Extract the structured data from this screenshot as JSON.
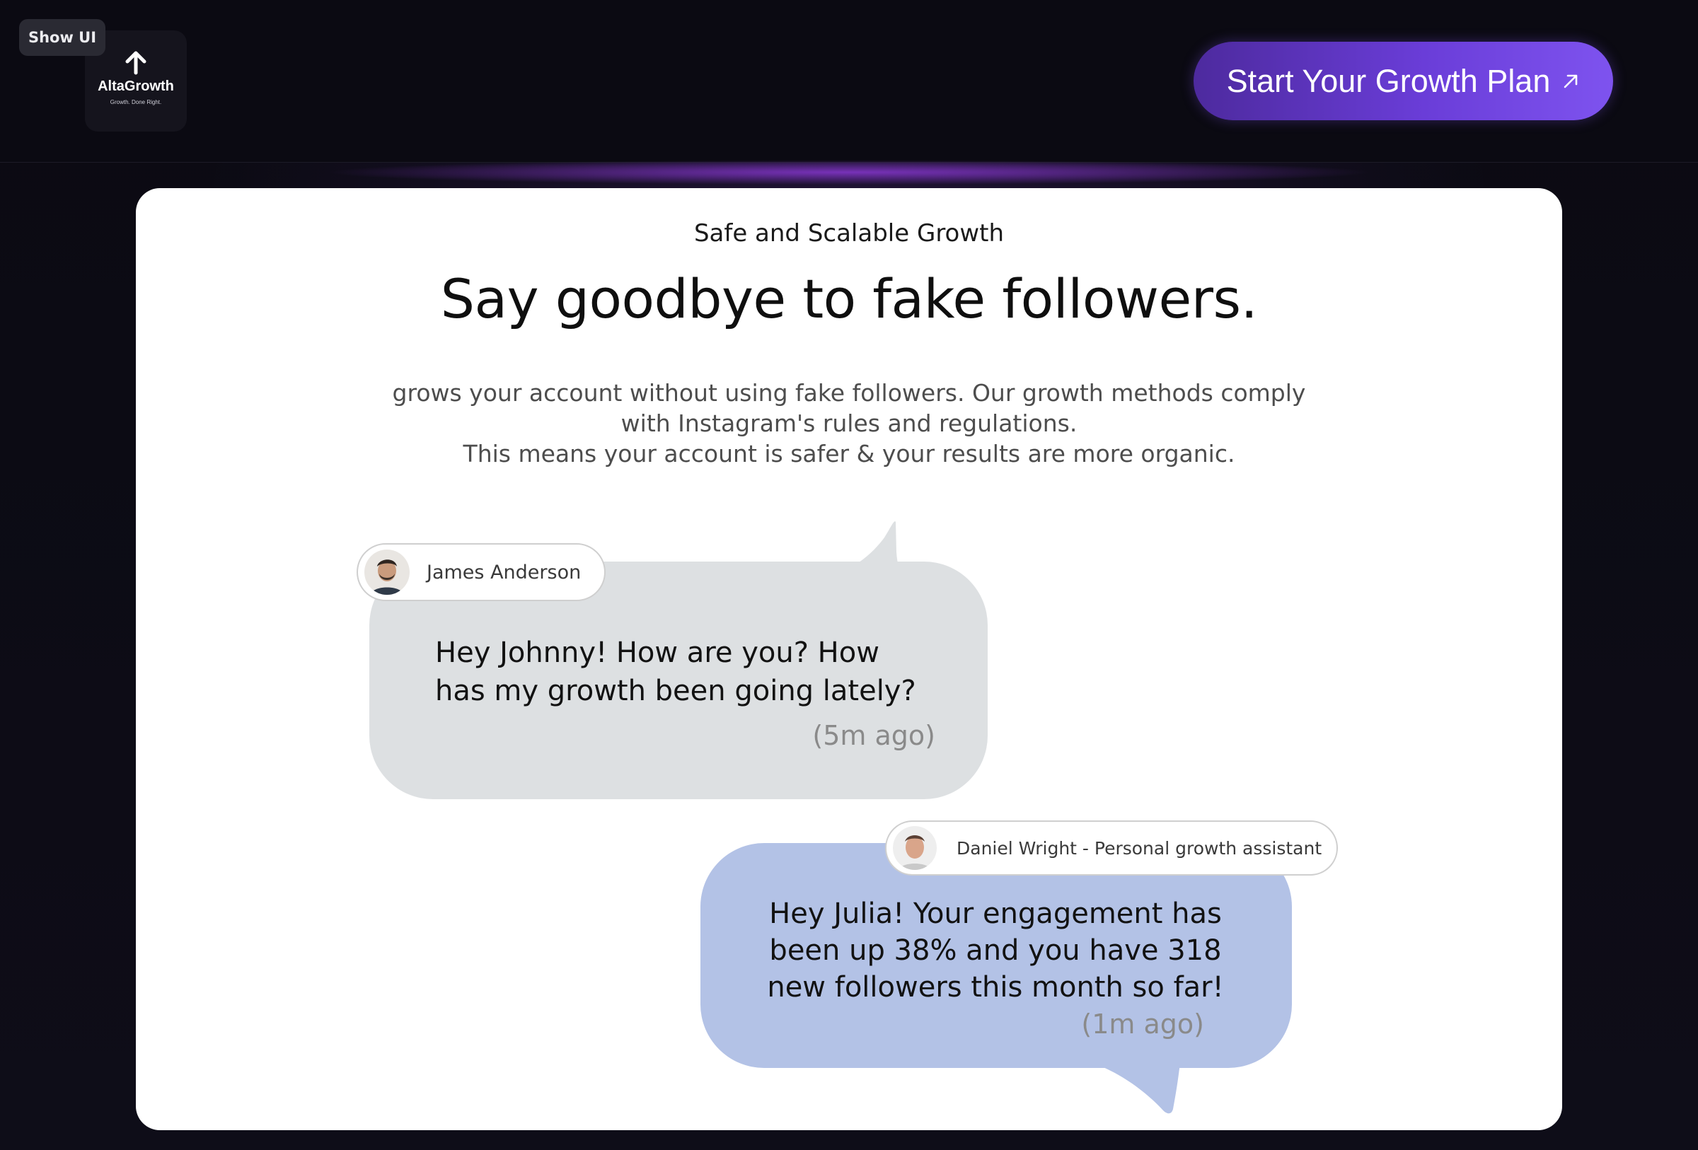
{
  "header": {
    "show_ui_label": "Show UI",
    "logo": {
      "name": "AltaGrowth",
      "tagline": "Growth. Done Right.",
      "icon": "arrow-up-icon"
    },
    "cta": {
      "label": "Start Your Growth Plan",
      "icon": "arrow-up-right-icon"
    }
  },
  "card": {
    "eyebrow": "Safe and Scalable Growth",
    "headline": "Say goodbye to fake followers.",
    "description_lines": [
      "grows your account without using fake followers. Our growth methods comply",
      "with Instagram's rules and regulations.",
      "This means your account is safer & your results are more organic."
    ]
  },
  "conversation": [
    {
      "sender": "James Anderson",
      "avatar": "avatar-photo",
      "message_lines": [
        "Hey Johnny! How are you? How",
        "has my growth been going lately?"
      ],
      "time": "(5m ago)",
      "bubble_color": "#dde0e2"
    },
    {
      "sender": "Daniel Wright - Personal growth assistant",
      "avatar": "avatar-photo",
      "message_lines": [
        "Hey Julia! Your engagement has",
        "been up 38% and you have 318",
        "new followers this month so far!"
      ],
      "time": "(1m ago)",
      "bubble_color": "#b3c2e6"
    }
  ],
  "colors": {
    "page_background": "#0c0b15",
    "accent_purple": "#6a3dd8",
    "card_background": "#ffffff"
  }
}
